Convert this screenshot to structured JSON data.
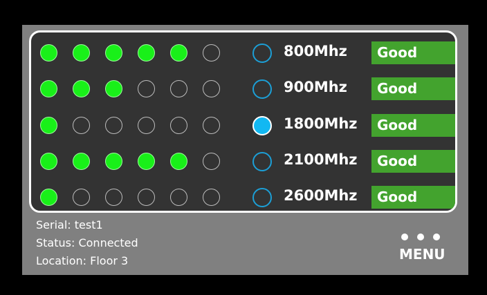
{
  "bands": [
    {
      "signal_bars_filled": 5,
      "signal_bars_total": 6,
      "selected": false,
      "frequency": "800Mhz",
      "quality": "Good"
    },
    {
      "signal_bars_filled": 3,
      "signal_bars_total": 6,
      "selected": false,
      "frequency": "900Mhz",
      "quality": "Good"
    },
    {
      "signal_bars_filled": 1,
      "signal_bars_total": 6,
      "selected": true,
      "frequency": "1800Mhz",
      "quality": "Good"
    },
    {
      "signal_bars_filled": 5,
      "signal_bars_total": 6,
      "selected": false,
      "frequency": "2100Mhz",
      "quality": "Good"
    },
    {
      "signal_bars_filled": 1,
      "signal_bars_total": 6,
      "selected": false,
      "frequency": "2600Mhz",
      "quality": "Good"
    }
  ],
  "footer": {
    "serial": "Serial: test1",
    "status": "Status: Connected",
    "location": "Location: Floor 3"
  },
  "menu": {
    "label": "MENU",
    "icon": "three-dots-icon"
  },
  "colors": {
    "signal_on": "#19f019",
    "radio_selected": "#12b8f2",
    "radio_border": "#1c9fd6",
    "quality_good": "#43a32e",
    "panel_bg": "#333333",
    "screen_bg": "#808080"
  }
}
